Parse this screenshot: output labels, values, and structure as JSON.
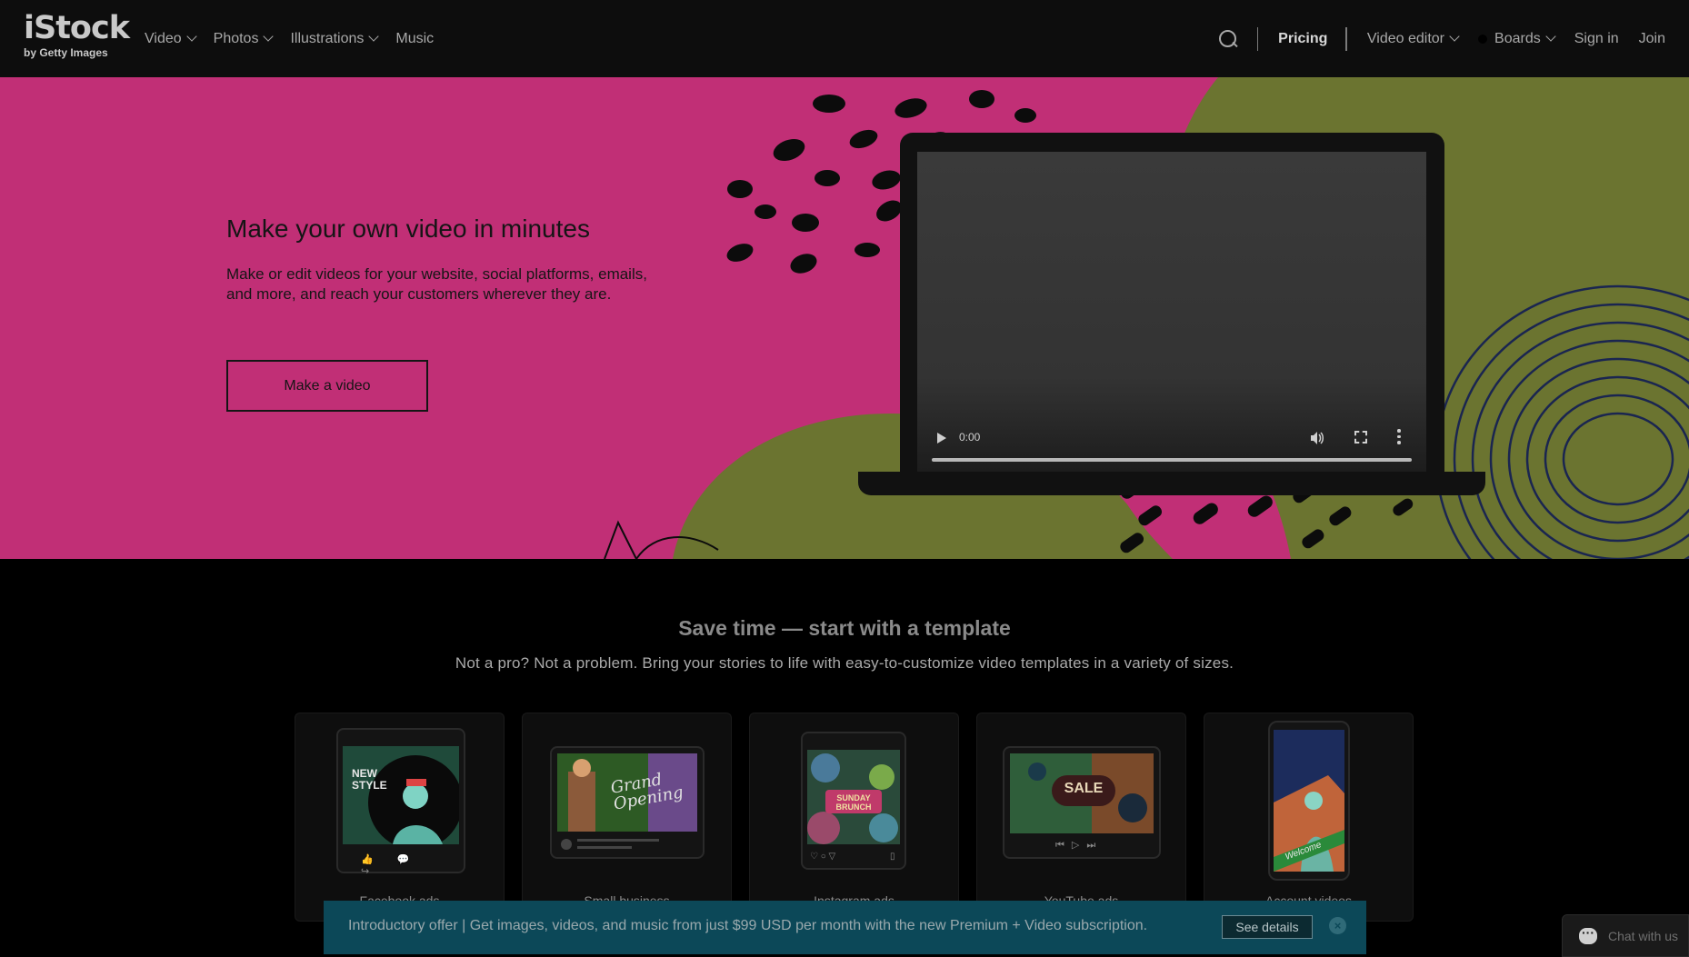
{
  "brand": {
    "name": "iStock",
    "tagline": "by Getty Images"
  },
  "nav": {
    "left": [
      {
        "label": "Video",
        "dropdown": true
      },
      {
        "label": "Photos",
        "dropdown": true
      },
      {
        "label": "Illustrations",
        "dropdown": true
      },
      {
        "label": "Music",
        "dropdown": false
      }
    ],
    "pricing": "Pricing",
    "video_editor": "Video editor",
    "boards": "Boards",
    "sign_in": "Sign in",
    "join": "Join"
  },
  "hero": {
    "title": "Make your own video in minutes",
    "description": "Make or edit videos for your website, social platforms, emails, and more, and reach your customers wherever they are.",
    "cta": "Make a video",
    "video": {
      "time": "0:00",
      "progress": 0
    },
    "colors": {
      "background": "#c12f76",
      "accent": "#6b7430"
    }
  },
  "templates": {
    "title": "Save time — start with a template",
    "subtitle": "Not a pro? Not a problem. Bring your stories to life with easy-to-customize video templates in a variety of sizes.",
    "cards": [
      {
        "label": "Facebook ads",
        "thumb_text": "NEW STYLE"
      },
      {
        "label": "Small business",
        "thumb_text": "Grand Opening"
      },
      {
        "label": "Instagram ads",
        "thumb_text": "SUNDAY BRUNCH"
      },
      {
        "label": "YouTube ads",
        "thumb_text": "SALE"
      },
      {
        "label": "Account videos",
        "thumb_text": "Welcome"
      }
    ]
  },
  "promo": {
    "text": "Introductory offer | Get images, videos, and music from just $99 USD per month with the new Premium + Video subscription.",
    "button": "See details",
    "close": "×"
  },
  "chat": {
    "label": "Chat with us"
  }
}
